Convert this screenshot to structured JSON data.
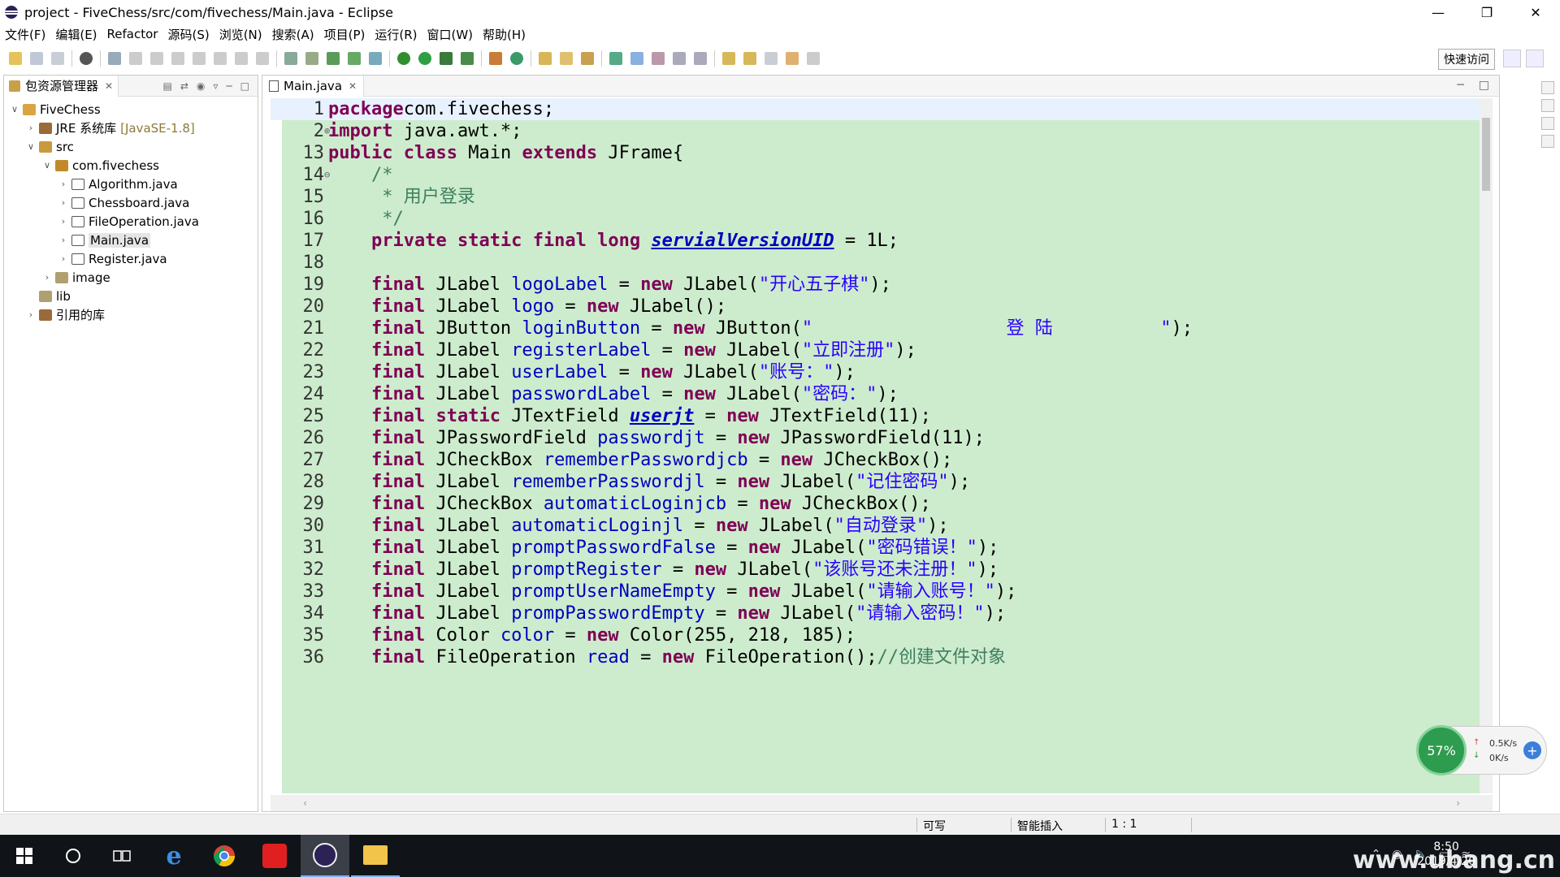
{
  "window": {
    "title": "project - FiveChess/src/com/fivechess/Main.java - Eclipse"
  },
  "menu": [
    "文件(F)",
    "编辑(E)",
    "Refactor",
    "源码(S)",
    "浏览(N)",
    "搜索(A)",
    "项目(P)",
    "运行(R)",
    "窗口(W)",
    "帮助(H)"
  ],
  "quick_access": "快速访问",
  "package_explorer": {
    "tab_label": "包资源管理器",
    "tree": [
      {
        "label": "FiveChess",
        "level": 0,
        "twisty": "v",
        "icon": "project-icon"
      },
      {
        "label": "JRE 系统库",
        "suffix": "[JavaSE-1.8]",
        "level": 1,
        "twisty": ">",
        "icon": "library-icon"
      },
      {
        "label": "src",
        "level": 1,
        "twisty": "v",
        "icon": "source-folder-icon"
      },
      {
        "label": "com.fivechess",
        "level": 2,
        "twisty": "v",
        "icon": "package-icon"
      },
      {
        "label": "Algorithm.java",
        "level": 3,
        "twisty": ">",
        "icon": "java-file-icon"
      },
      {
        "label": "Chessboard.java",
        "level": 3,
        "twisty": ">",
        "icon": "java-file-icon"
      },
      {
        "label": "FileOperation.java",
        "level": 3,
        "twisty": ">",
        "icon": "java-file-icon"
      },
      {
        "label": "Main.java",
        "level": 3,
        "twisty": ">",
        "icon": "java-file-icon",
        "selected": true
      },
      {
        "label": "Register.java",
        "level": 3,
        "twisty": ">",
        "icon": "java-file-icon"
      },
      {
        "label": "image",
        "level": 2,
        "twisty": ">",
        "icon": "folder-icon"
      },
      {
        "label": "lib",
        "level": 1,
        "twisty": "",
        "icon": "folder-icon"
      },
      {
        "label": "引用的库",
        "level": 1,
        "twisty": ">",
        "icon": "library-icon"
      }
    ]
  },
  "editor": {
    "tab_label": "Main.java",
    "lines": [
      {
        "n": "1",
        "fold": "",
        "tokens": [
          [
            "kw",
            "package"
          ],
          [
            "",
            "com.fivechess;"
          ]
        ]
      },
      {
        "n": "2",
        "fold": "+",
        "tokens": [
          [
            "kw",
            "import"
          ],
          [
            "",
            " java.awt.*;"
          ]
        ]
      },
      {
        "n": "13",
        "fold": "",
        "tokens": [
          [
            "kw",
            "public"
          ],
          [
            "",
            " "
          ],
          [
            "kw",
            "class"
          ],
          [
            "",
            " Main "
          ],
          [
            "kw",
            "extends"
          ],
          [
            "",
            " JFrame{"
          ]
        ]
      },
      {
        "n": "14",
        "fold": "-",
        "tokens": [
          [
            "cmt",
            "    /*"
          ]
        ]
      },
      {
        "n": "15",
        "fold": "",
        "tokens": [
          [
            "cmt",
            "     * 用户登录"
          ]
        ]
      },
      {
        "n": "16",
        "fold": "",
        "tokens": [
          [
            "cmt",
            "     */"
          ]
        ]
      },
      {
        "n": "17",
        "fold": "",
        "tokens": [
          [
            "",
            "    "
          ],
          [
            "kw",
            "private"
          ],
          [
            "",
            " "
          ],
          [
            "kw",
            "static"
          ],
          [
            "",
            " "
          ],
          [
            "kw",
            "final"
          ],
          [
            "",
            " "
          ],
          [
            "kw",
            "long"
          ],
          [
            "",
            " "
          ],
          [
            "sfld",
            "servialVersionUID"
          ],
          [
            "",
            " = 1L;"
          ]
        ]
      },
      {
        "n": "18",
        "fold": "",
        "tokens": [
          [
            "",
            ""
          ]
        ]
      },
      {
        "n": "19",
        "fold": "",
        "tokens": [
          [
            "",
            "    "
          ],
          [
            "kw",
            "final"
          ],
          [
            "",
            " JLabel "
          ],
          [
            "fld",
            "logoLabel"
          ],
          [
            "",
            " = "
          ],
          [
            "kw",
            "new"
          ],
          [
            "",
            " JLabel("
          ],
          [
            "str",
            "\"开心五子棋\""
          ],
          [
            "",
            ");"
          ]
        ]
      },
      {
        "n": "20",
        "fold": "",
        "tokens": [
          [
            "",
            "    "
          ],
          [
            "kw",
            "final"
          ],
          [
            "",
            " JLabel "
          ],
          [
            "fld",
            "logo"
          ],
          [
            "",
            " = "
          ],
          [
            "kw",
            "new"
          ],
          [
            "",
            " JLabel();"
          ]
        ]
      },
      {
        "n": "21",
        "fold": "",
        "tokens": [
          [
            "",
            "    "
          ],
          [
            "kw",
            "final"
          ],
          [
            "",
            " JButton "
          ],
          [
            "fld",
            "loginButton"
          ],
          [
            "",
            " = "
          ],
          [
            "kw",
            "new"
          ],
          [
            "",
            " JButton("
          ],
          [
            "str",
            "\"                  登 陆          \""
          ],
          [
            "",
            ");"
          ]
        ]
      },
      {
        "n": "22",
        "fold": "",
        "tokens": [
          [
            "",
            "    "
          ],
          [
            "kw",
            "final"
          ],
          [
            "",
            " JLabel "
          ],
          [
            "fld",
            "registerLabel"
          ],
          [
            "",
            " = "
          ],
          [
            "kw",
            "new"
          ],
          [
            "",
            " JLabel("
          ],
          [
            "str",
            "\"立即注册\""
          ],
          [
            "",
            ");"
          ]
        ]
      },
      {
        "n": "23",
        "fold": "",
        "tokens": [
          [
            "",
            "    "
          ],
          [
            "kw",
            "final"
          ],
          [
            "",
            " JLabel "
          ],
          [
            "fld",
            "userLabel"
          ],
          [
            "",
            " = "
          ],
          [
            "kw",
            "new"
          ],
          [
            "",
            " JLabel("
          ],
          [
            "str",
            "\"账号：\""
          ],
          [
            "",
            ");"
          ]
        ]
      },
      {
        "n": "24",
        "fold": "",
        "tokens": [
          [
            "",
            "    "
          ],
          [
            "kw",
            "final"
          ],
          [
            "",
            " JLabel "
          ],
          [
            "fld",
            "passwordLabel"
          ],
          [
            "",
            " = "
          ],
          [
            "kw",
            "new"
          ],
          [
            "",
            " JLabel("
          ],
          [
            "str",
            "\"密码：\""
          ],
          [
            "",
            ");"
          ]
        ]
      },
      {
        "n": "25",
        "fold": "",
        "tokens": [
          [
            "",
            "    "
          ],
          [
            "kw",
            "final"
          ],
          [
            "",
            " "
          ],
          [
            "kw",
            "static"
          ],
          [
            "",
            " JTextField "
          ],
          [
            "sfld",
            "userjt"
          ],
          [
            "",
            " = "
          ],
          [
            "kw",
            "new"
          ],
          [
            "",
            " JTextField(11);"
          ]
        ]
      },
      {
        "n": "26",
        "fold": "",
        "tokens": [
          [
            "",
            "    "
          ],
          [
            "kw",
            "final"
          ],
          [
            "",
            " JPasswordField "
          ],
          [
            "fld",
            "passwordjt"
          ],
          [
            "",
            " = "
          ],
          [
            "kw",
            "new"
          ],
          [
            "",
            " JPasswordField(11);"
          ]
        ]
      },
      {
        "n": "27",
        "fold": "",
        "tokens": [
          [
            "",
            "    "
          ],
          [
            "kw",
            "final"
          ],
          [
            "",
            " JCheckBox "
          ],
          [
            "fld",
            "rememberPasswordjcb"
          ],
          [
            "",
            " = "
          ],
          [
            "kw",
            "new"
          ],
          [
            "",
            " JCheckBox();"
          ]
        ]
      },
      {
        "n": "28",
        "fold": "",
        "tokens": [
          [
            "",
            "    "
          ],
          [
            "kw",
            "final"
          ],
          [
            "",
            " JLabel "
          ],
          [
            "fld",
            "rememberPasswordjl"
          ],
          [
            "",
            " = "
          ],
          [
            "kw",
            "new"
          ],
          [
            "",
            " JLabel("
          ],
          [
            "str",
            "\"记住密码\""
          ],
          [
            "",
            ");"
          ]
        ]
      },
      {
        "n": "29",
        "fold": "",
        "tokens": [
          [
            "",
            "    "
          ],
          [
            "kw",
            "final"
          ],
          [
            "",
            " JCheckBox "
          ],
          [
            "fld",
            "automaticLoginjcb"
          ],
          [
            "",
            " = "
          ],
          [
            "kw",
            "new"
          ],
          [
            "",
            " JCheckBox();"
          ]
        ]
      },
      {
        "n": "30",
        "fold": "",
        "tokens": [
          [
            "",
            "    "
          ],
          [
            "kw",
            "final"
          ],
          [
            "",
            " JLabel "
          ],
          [
            "fld",
            "automaticLoginjl"
          ],
          [
            "",
            " = "
          ],
          [
            "kw",
            "new"
          ],
          [
            "",
            " JLabel("
          ],
          [
            "str",
            "\"自动登录\""
          ],
          [
            "",
            ");"
          ]
        ]
      },
      {
        "n": "31",
        "fold": "",
        "tokens": [
          [
            "",
            "    "
          ],
          [
            "kw",
            "final"
          ],
          [
            "",
            " JLabel "
          ],
          [
            "fld",
            "promptPasswordFalse"
          ],
          [
            "",
            " = "
          ],
          [
            "kw",
            "new"
          ],
          [
            "",
            " JLabel("
          ],
          [
            "str",
            "\"密码错误！\""
          ],
          [
            "",
            ");"
          ]
        ]
      },
      {
        "n": "32",
        "fold": "",
        "tokens": [
          [
            "",
            "    "
          ],
          [
            "kw",
            "final"
          ],
          [
            "",
            " JLabel "
          ],
          [
            "fld",
            "promptRegister"
          ],
          [
            "",
            " = "
          ],
          [
            "kw",
            "new"
          ],
          [
            "",
            " JLabel("
          ],
          [
            "str",
            "\"该账号还未注册！\""
          ],
          [
            "",
            ");"
          ]
        ]
      },
      {
        "n": "33",
        "fold": "",
        "tokens": [
          [
            "",
            "    "
          ],
          [
            "kw",
            "final"
          ],
          [
            "",
            " JLabel "
          ],
          [
            "fld",
            "promptUserNameEmpty"
          ],
          [
            "",
            " = "
          ],
          [
            "kw",
            "new"
          ],
          [
            "",
            " JLabel("
          ],
          [
            "str",
            "\"请输入账号！\""
          ],
          [
            "",
            ");"
          ]
        ]
      },
      {
        "n": "34",
        "fold": "",
        "tokens": [
          [
            "",
            "    "
          ],
          [
            "kw",
            "final"
          ],
          [
            "",
            " JLabel "
          ],
          [
            "fld",
            "prompPasswordEmpty"
          ],
          [
            "",
            " = "
          ],
          [
            "kw",
            "new"
          ],
          [
            "",
            " JLabel("
          ],
          [
            "str",
            "\"请输入密码！\""
          ],
          [
            "",
            ");"
          ]
        ]
      },
      {
        "n": "35",
        "fold": "",
        "tokens": [
          [
            "",
            "    "
          ],
          [
            "kw",
            "final"
          ],
          [
            "",
            " Color "
          ],
          [
            "fld",
            "color"
          ],
          [
            "",
            " = "
          ],
          [
            "kw",
            "new"
          ],
          [
            "",
            " Color(255, 218, 185);"
          ]
        ]
      },
      {
        "n": "36",
        "fold": "",
        "tokens": [
          [
            "",
            "    "
          ],
          [
            "kw",
            "final"
          ],
          [
            "",
            " FileOperation "
          ],
          [
            "fld",
            "read"
          ],
          [
            "",
            " = "
          ],
          [
            "kw",
            "new"
          ],
          [
            "",
            " FileOperation();"
          ],
          [
            "cmt",
            "//创建文件对象"
          ]
        ]
      }
    ]
  },
  "status": {
    "writable": "可写",
    "insert_mode": "智能插入",
    "position": "1 : 1"
  },
  "net_widget": {
    "percent": "57%",
    "up": "0.5K/s",
    "down": "0K/s"
  },
  "taskbar": {
    "time": "8:50",
    "date": "2019/4/20",
    "watermark": "www.ubang.cn"
  },
  "colors": {
    "code_bg": "#cdeccd",
    "keyword": "#7f0055",
    "field": "#0000c0",
    "string": "#2a00ff",
    "comment": "#3f7f5f"
  }
}
